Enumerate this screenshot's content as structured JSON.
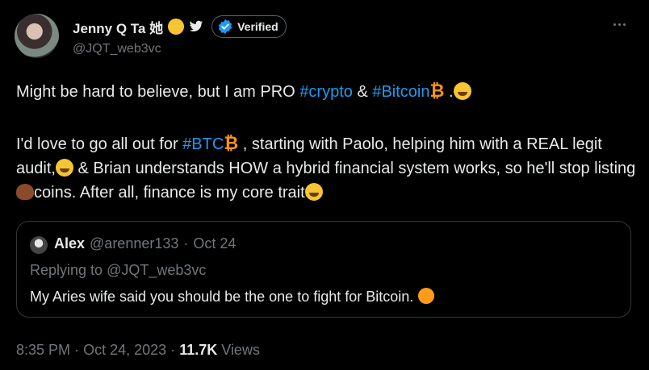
{
  "author": {
    "display_name": "Jenny Q Ta 她",
    "handle": "@JQT_web3vc",
    "verified_label": "Verified"
  },
  "tweet": {
    "para1": {
      "t1": "Might be hard to believe, but I am PRO ",
      "tag1": "#crypto",
      "t2": " & ",
      "tag2": "#Bitcoin",
      "emoji_btc": "₿",
      "t3": " ."
    },
    "para2": {
      "t1": "I'd love to go all out for ",
      "tag1": "#BTC",
      "emoji_btc": "₿",
      "t2": " , starting with Paolo, helping him with a REAL legit audit,",
      "t3": " & Brian understands HOW a hybrid financial system works, so he'll stop listing ",
      "t4": "coins. After all, finance is my core trait"
    }
  },
  "quote": {
    "name": "Alex",
    "handle": "@arenner133",
    "separator": "·",
    "date": "Oct 24",
    "replying_prefix": "Replying to ",
    "replying_handle": "@JQT_web3vc",
    "text": "My Aries wife said you should be the one to fight for Bitcoin."
  },
  "meta": {
    "time": "8:35 PM",
    "separator": "·",
    "date": "Oct 24, 2023",
    "views_count": "11.7K",
    "views_label": "Views"
  },
  "colors": {
    "background": "#000000",
    "text": "#e7e9ea",
    "secondary": "#71767b",
    "link": "#1d9bf0",
    "verified": "#1d9bf0",
    "bitcoin": "#f7931a"
  },
  "icons": [
    "avatar",
    "face-emoji",
    "bird-icon",
    "verified-badge-icon",
    "more-icon",
    "bitcoin-emoji",
    "smile-emoji",
    "wink-emoji",
    "poop-emoji",
    "orange-circle-emoji"
  ]
}
